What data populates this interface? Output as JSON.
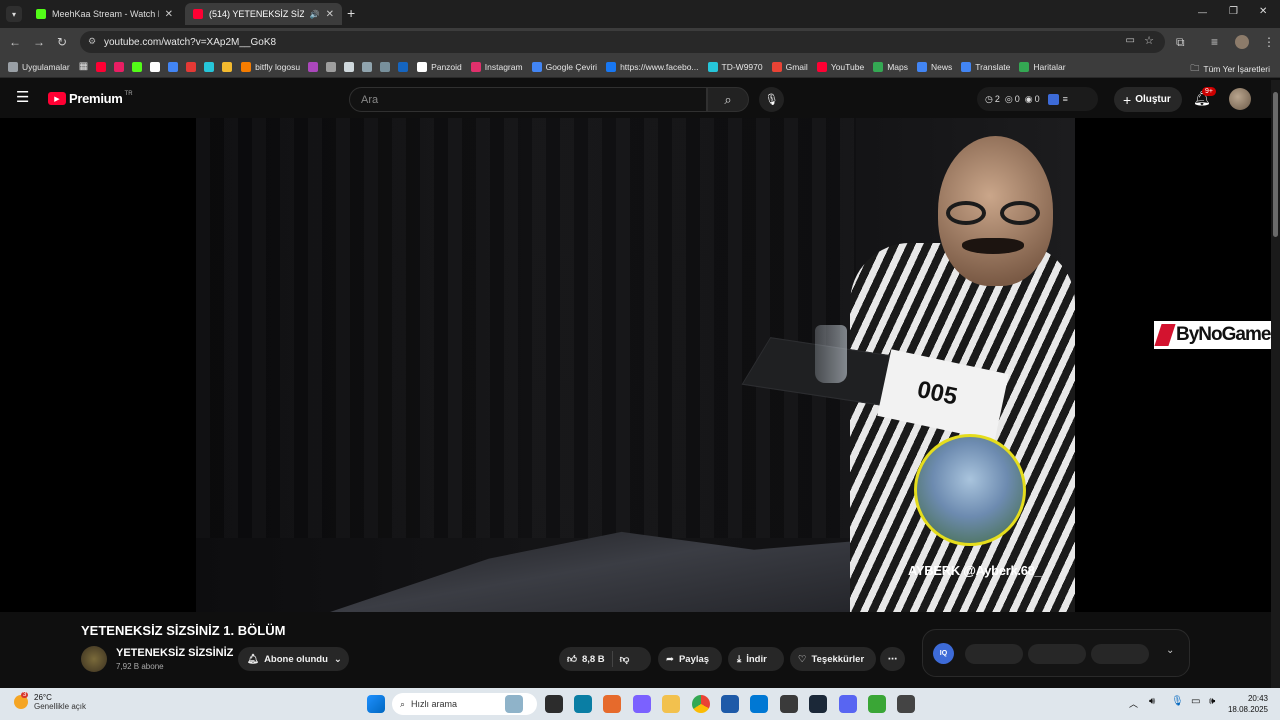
{
  "browser": {
    "tabs": [
      {
        "title": "MeehKaa Stream - Watch Live o",
        "close": "✕",
        "favicon_color": "#53fc18"
      },
      {
        "title": "(514) YETENEKSİZ SİZSİNİZ",
        "close": "✕",
        "favicon_color": "#ff0033"
      }
    ],
    "new_tab": "+",
    "url": "youtube.com/watch?v=XAp2M__GoK8",
    "window_controls": {
      "minimize": "—",
      "restore": "❐",
      "close": "✕"
    }
  },
  "bookmarks": {
    "apps_label": "Uygulamalar",
    "items": [
      {
        "label": "",
        "color": "#ff0033"
      },
      {
        "label": "",
        "color": "#e91e63"
      },
      {
        "label": "",
        "color": "#53fc18"
      },
      {
        "label": "",
        "color": "#ffffff"
      },
      {
        "label": "",
        "color": "#4285f4"
      },
      {
        "label": "",
        "color": "#e53935"
      },
      {
        "label": "",
        "color": "#26c6da"
      },
      {
        "label": "",
        "color": "#f3ba2f"
      },
      {
        "label": "bitfly logosu",
        "color": "#f57c00"
      },
      {
        "label": "",
        "color": "#ab47bc"
      },
      {
        "label": "",
        "color": "#9e9e9e"
      },
      {
        "label": "",
        "color": "#cfd8dc"
      },
      {
        "label": "",
        "color": "#90a4ae"
      },
      {
        "label": "",
        "color": "#78909c"
      },
      {
        "label": "",
        "color": "#1565c0"
      },
      {
        "label": "Panzoid",
        "color": "#ffffff"
      },
      {
        "label": "Instagram",
        "color": "#e1306c"
      },
      {
        "label": "Google Çeviri",
        "color": "#4285f4"
      },
      {
        "label": "https://www.facebo...",
        "color": "#1877f2"
      },
      {
        "label": "TD-W9970",
        "color": "#26c6da"
      },
      {
        "label": "Gmail",
        "color": "#ea4335"
      },
      {
        "label": "YouTube",
        "color": "#ff0033"
      },
      {
        "label": "Maps",
        "color": "#34a853"
      },
      {
        "label": "News",
        "color": "#4285f4"
      },
      {
        "label": "Translate",
        "color": "#4285f4"
      },
      {
        "label": "Haritalar",
        "color": "#34a853"
      }
    ],
    "all_bookmarks": "Tüm Yer İşaretleri"
  },
  "youtube": {
    "logo_text": "Premium",
    "logo_region": "TR",
    "search_placeholder": "Ara",
    "ext_counts": [
      "2",
      "0",
      "0"
    ],
    "create_label": "Oluştur",
    "notif_badge": "9+",
    "video": {
      "overlay_handle": "AYBERK @Ayberk.68_",
      "number_card": "005",
      "watermark": "ByNoGame"
    },
    "title": "YETENEKSİZ SİZSİNİZ 1. BÖLÜM",
    "channel": {
      "name": "YETENEKSİZ SİZSİNİZ",
      "subs": "7,92 B abone"
    },
    "subscribe_label": "Abone olundu",
    "like_count": "8,8 B",
    "share_label": "Paylaş",
    "download_label": "İndir",
    "thanks_label": "Teşekkürler",
    "more_label": "⋯",
    "iq_label": "IQ"
  },
  "taskbar": {
    "weather_temp": "26°C",
    "weather_desc": "Genellikle açık",
    "weather_badge": "3",
    "search_label": "Hızlı arama",
    "time": "20:43",
    "date": "18.08.2025"
  },
  "colors": {
    "brand_red": "#ff0033",
    "accent_yellow": "#e5dd1c"
  }
}
